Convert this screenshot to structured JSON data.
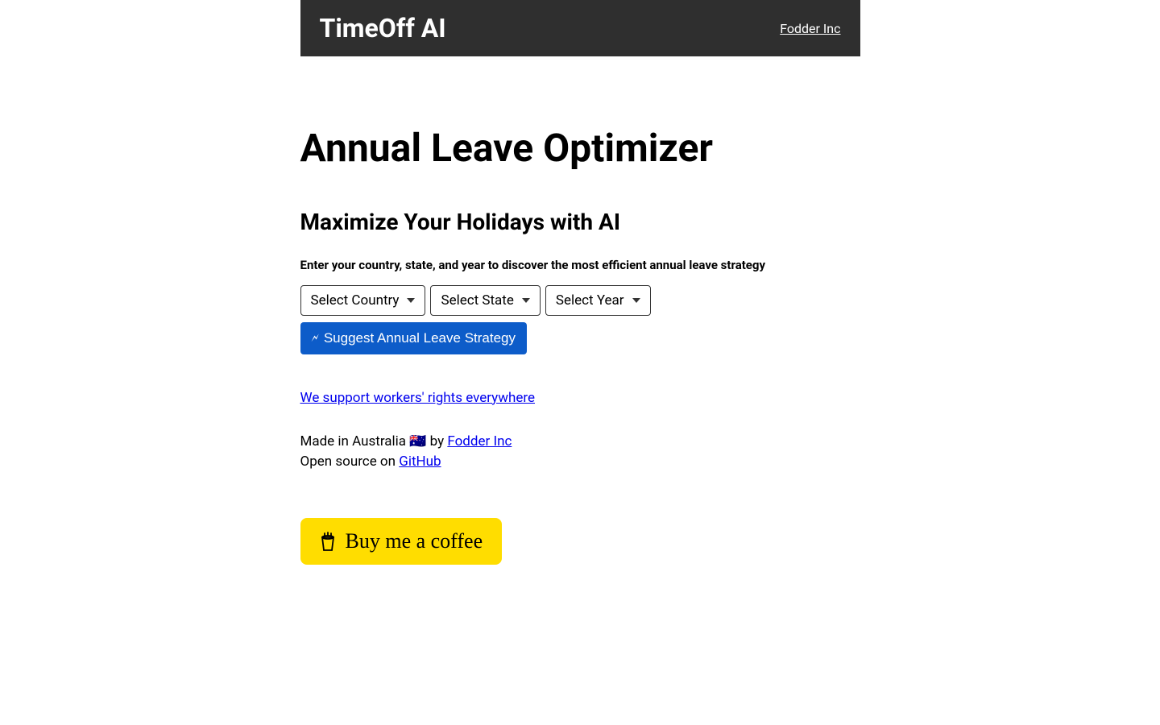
{
  "header": {
    "title": "TimeOff AI",
    "link_label": "Fodder Inc"
  },
  "main": {
    "page_title": "Annual Leave Optimizer",
    "subtitle": "Maximize Your Holidays with AI",
    "instructions": "Enter your country, state, and year to discover the most efficient annual leave strategy",
    "country_select": "Select Country",
    "state_select": "Select State",
    "year_select": "Select Year",
    "suggest_button": "Suggest Annual Leave Strategy",
    "workers_link": "We support workers' rights everywhere"
  },
  "footer": {
    "made_in_prefix": "Made in Australia 🇦🇺 by ",
    "fodder_link": "Fodder Inc",
    "open_source_prefix": "Open source on ",
    "github_link": "GitHub",
    "bmc_label": "Buy me a coffee"
  }
}
